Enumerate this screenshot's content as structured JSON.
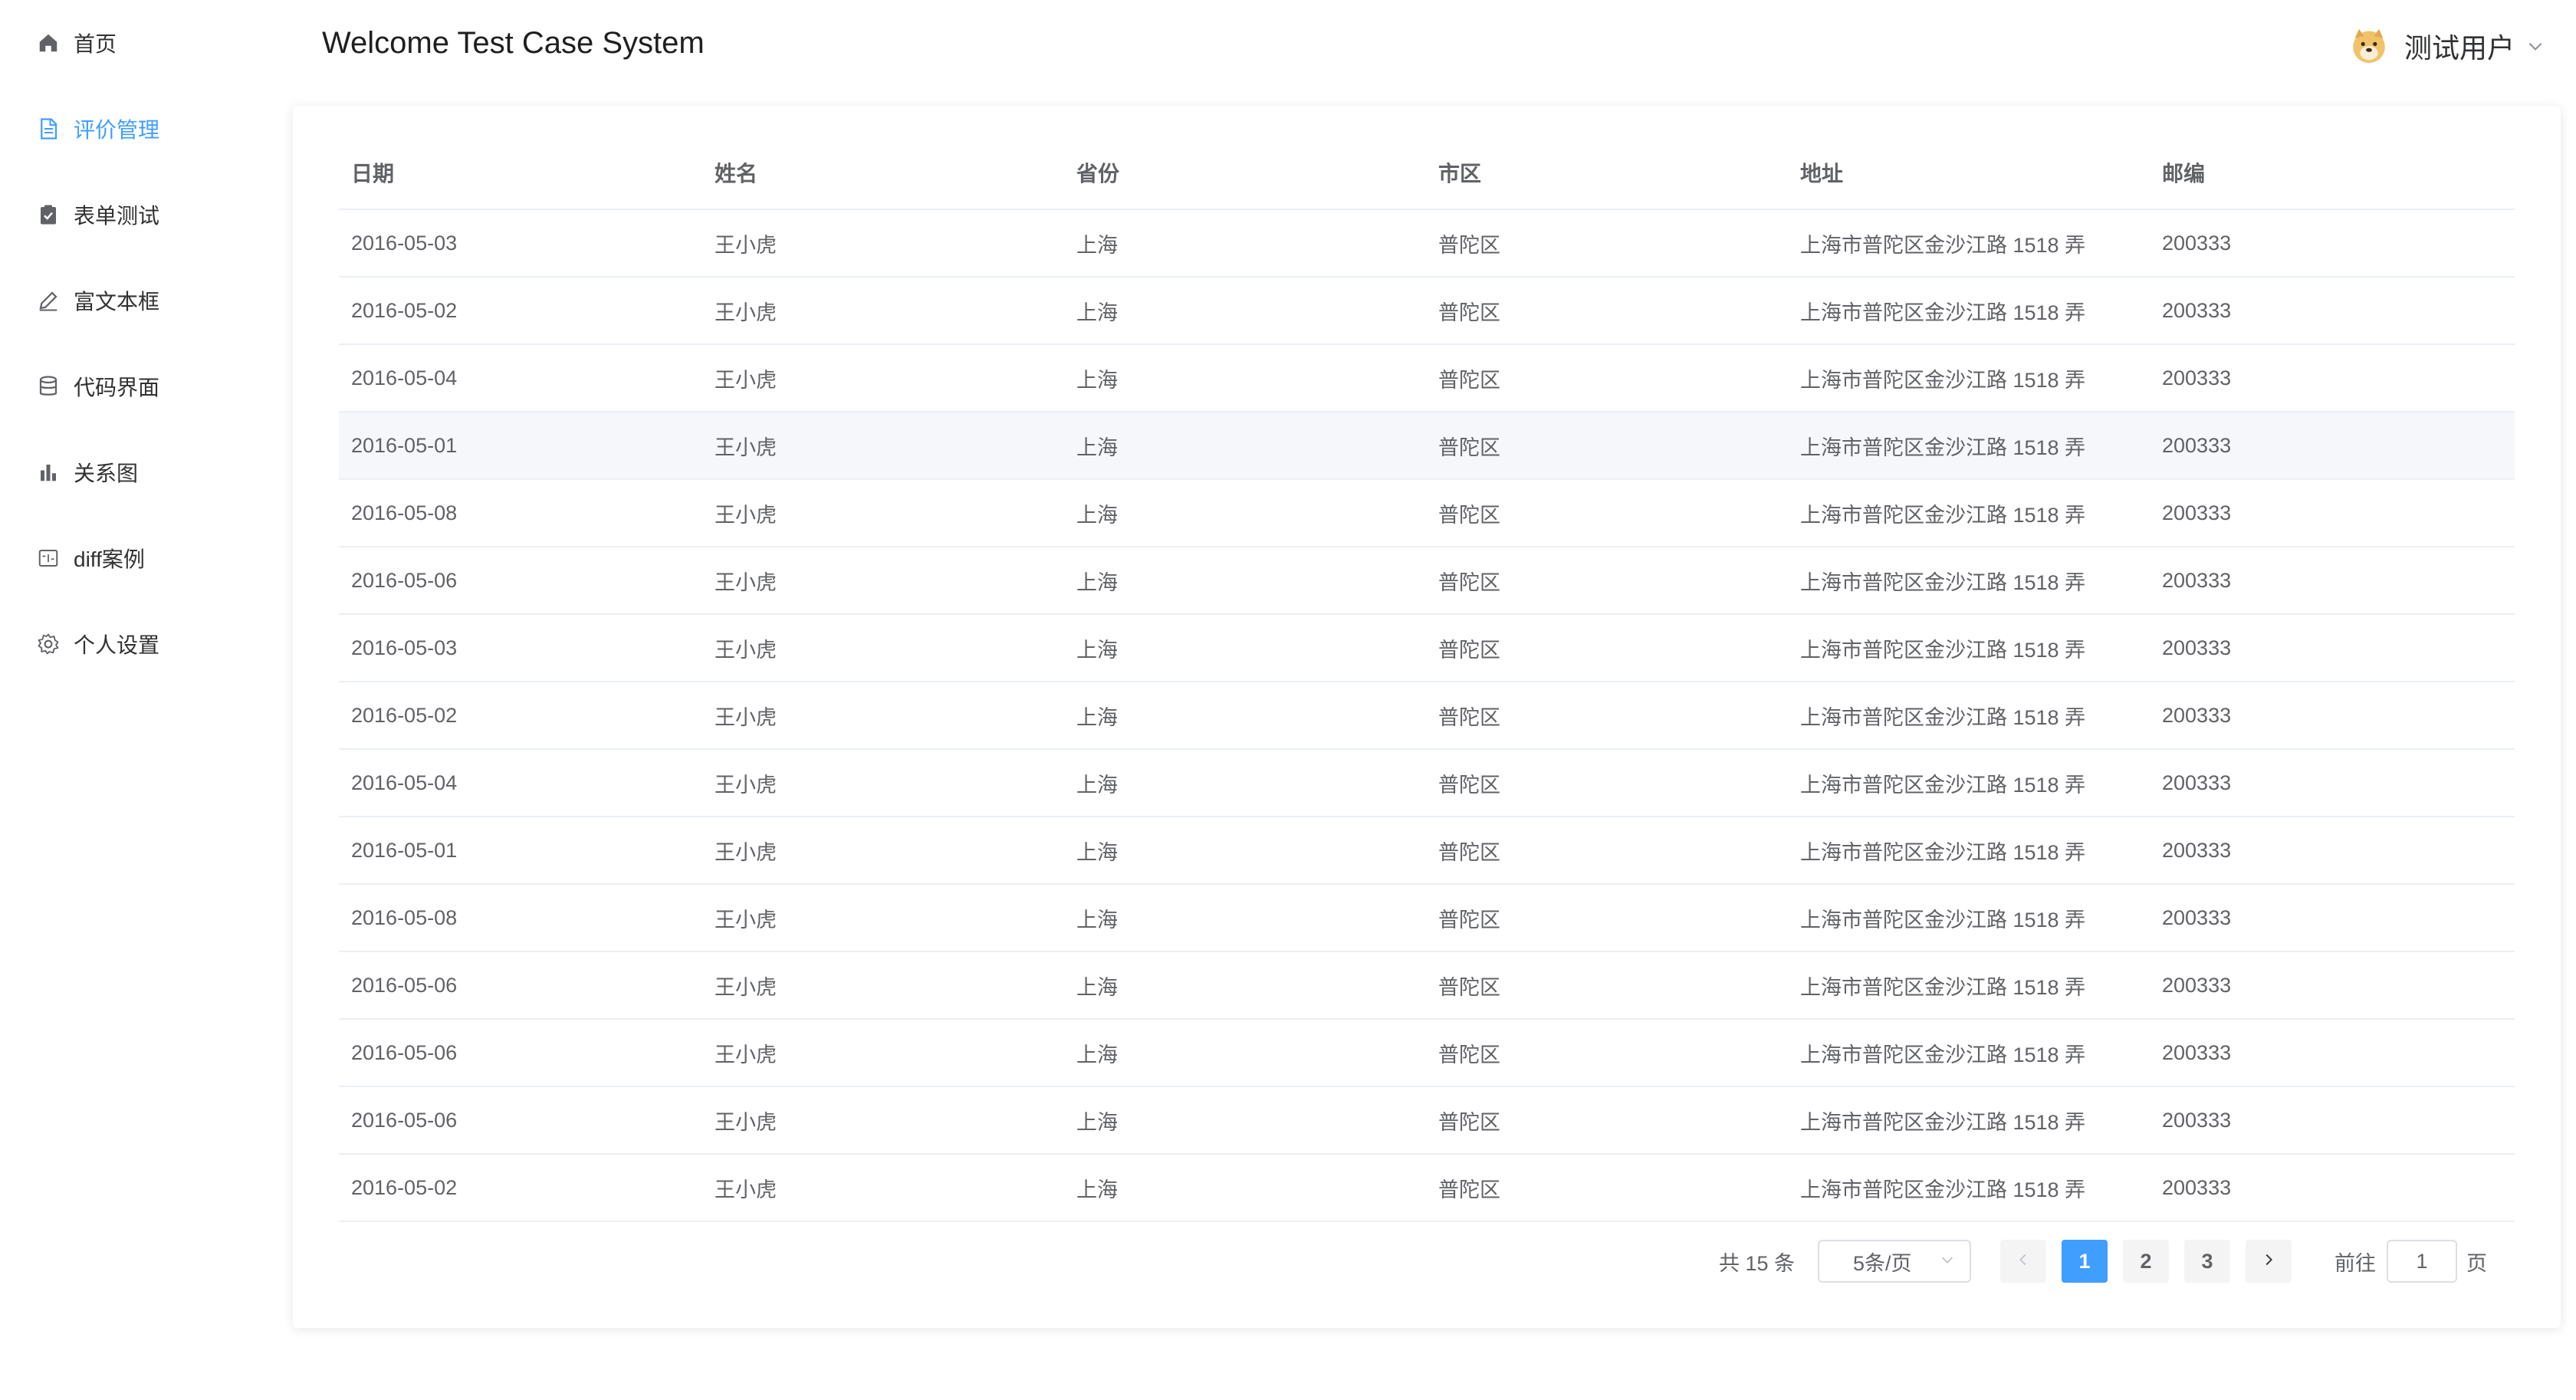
{
  "sidebar": {
    "items": [
      {
        "label": "首页",
        "icon": "home-icon",
        "active": false
      },
      {
        "label": "评价管理",
        "icon": "document-icon",
        "active": true
      },
      {
        "label": "表单测试",
        "icon": "clipboard-check-icon",
        "active": false
      },
      {
        "label": "富文本框",
        "icon": "edit-pen-icon",
        "active": false
      },
      {
        "label": "代码界面",
        "icon": "database-icon",
        "active": false
      },
      {
        "label": "关系图",
        "icon": "bar-chart-icon",
        "active": false
      },
      {
        "label": "diff案例",
        "icon": "diff-window-icon",
        "active": false
      },
      {
        "label": "个人设置",
        "icon": "gear-icon",
        "active": false
      }
    ]
  },
  "header": {
    "title": "Welcome Test Case System",
    "user_name": "测试用户",
    "avatar_icon": "doge-avatar-icon"
  },
  "table": {
    "columns": [
      "日期",
      "姓名",
      "省份",
      "市区",
      "地址",
      "邮编"
    ],
    "rows": [
      [
        "2016-05-03",
        "王小虎",
        "上海",
        "普陀区",
        "上海市普陀区金沙江路 1518 弄",
        "200333"
      ],
      [
        "2016-05-02",
        "王小虎",
        "上海",
        "普陀区",
        "上海市普陀区金沙江路 1518 弄",
        "200333"
      ],
      [
        "2016-05-04",
        "王小虎",
        "上海",
        "普陀区",
        "上海市普陀区金沙江路 1518 弄",
        "200333"
      ],
      [
        "2016-05-01",
        "王小虎",
        "上海",
        "普陀区",
        "上海市普陀区金沙江路 1518 弄",
        "200333"
      ],
      [
        "2016-05-08",
        "王小虎",
        "上海",
        "普陀区",
        "上海市普陀区金沙江路 1518 弄",
        "200333"
      ],
      [
        "2016-05-06",
        "王小虎",
        "上海",
        "普陀区",
        "上海市普陀区金沙江路 1518 弄",
        "200333"
      ],
      [
        "2016-05-03",
        "王小虎",
        "上海",
        "普陀区",
        "上海市普陀区金沙江路 1518 弄",
        "200333"
      ],
      [
        "2016-05-02",
        "王小虎",
        "上海",
        "普陀区",
        "上海市普陀区金沙江路 1518 弄",
        "200333"
      ],
      [
        "2016-05-04",
        "王小虎",
        "上海",
        "普陀区",
        "上海市普陀区金沙江路 1518 弄",
        "200333"
      ],
      [
        "2016-05-01",
        "王小虎",
        "上海",
        "普陀区",
        "上海市普陀区金沙江路 1518 弄",
        "200333"
      ],
      [
        "2016-05-08",
        "王小虎",
        "上海",
        "普陀区",
        "上海市普陀区金沙江路 1518 弄",
        "200333"
      ],
      [
        "2016-05-06",
        "王小虎",
        "上海",
        "普陀区",
        "上海市普陀区金沙江路 1518 弄",
        "200333"
      ],
      [
        "2016-05-06",
        "王小虎",
        "上海",
        "普陀区",
        "上海市普陀区金沙江路 1518 弄",
        "200333"
      ],
      [
        "2016-05-06",
        "王小虎",
        "上海",
        "普陀区",
        "上海市普陀区金沙江路 1518 弄",
        "200333"
      ],
      [
        "2016-05-02",
        "王小虎",
        "上海",
        "普陀区",
        "上海市普陀区金沙江路 1518 弄",
        "200333"
      ]
    ],
    "hover_row": 3
  },
  "pagination": {
    "total_text": "共 15 条",
    "page_size": "5条/页",
    "pages": [
      "1",
      "2",
      "3"
    ],
    "current_page": "1",
    "jump_prefix": "前往",
    "jump_value": "1",
    "jump_suffix": "页",
    "prev_icon": "chevron-left-icon",
    "next_icon": "chevron-right-icon"
  },
  "colors": {
    "accent": "#409eff",
    "text": "#606266",
    "border": "#ebeef5",
    "hover_bg": "#f5f7fa"
  }
}
